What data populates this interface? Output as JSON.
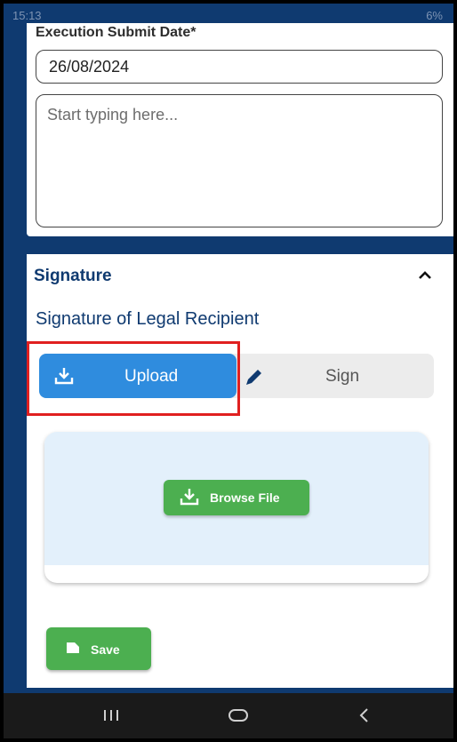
{
  "status_bar": {
    "time": "15:13",
    "battery": "6%"
  },
  "form": {
    "execution_date_label": "Execution Submit Date*",
    "execution_date_value": "26/08/2024",
    "notes_placeholder": "Start typing here..."
  },
  "signature": {
    "section_title": "Signature",
    "subtitle": "Signature of Legal Recipient",
    "upload_label": "Upload",
    "sign_label": "Sign",
    "browse_label": "Browse File",
    "save_label": "Save"
  },
  "colors": {
    "primary_dark": "#0f3a70",
    "upload_blue": "#2f8cde",
    "success_green": "#4caf50",
    "highlight_red": "#e02020"
  },
  "icons": [
    "upload-icon",
    "pencil-icon",
    "download-icon",
    "file-icon",
    "chevron-up-icon",
    "recents-icon",
    "home-icon",
    "back-icon"
  ]
}
